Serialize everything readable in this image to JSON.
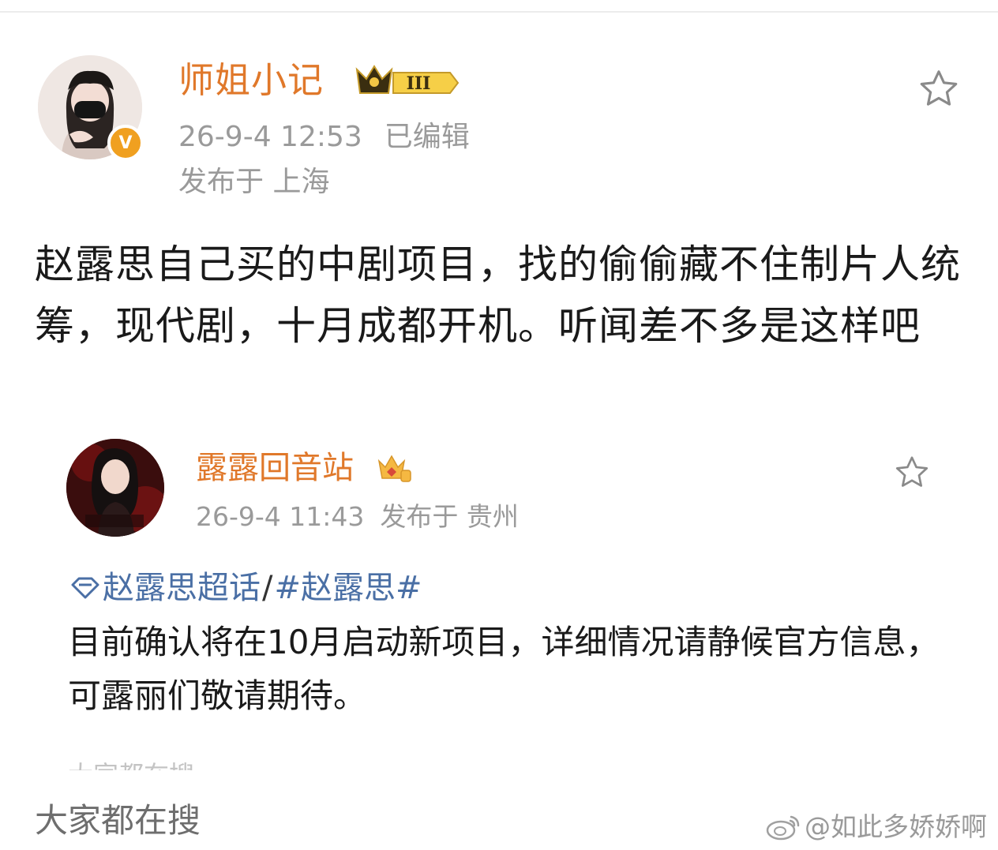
{
  "main_post": {
    "username": "师姐小记",
    "level_badge": "III",
    "verified_icon": "v-icon",
    "timestamp": "26-9-4 12:53",
    "edited": "已编辑",
    "location": "发布于 上海",
    "content": "赵露思自己买的中剧项目，找的偷偷藏不住制片人统筹，现代剧，十月成都开机。听闻差不多是这样吧"
  },
  "quoted_post": {
    "username": "露露回音站",
    "timestamp": "26-9-4 11:43",
    "location": "发布于 贵州",
    "topic": "赵露思超话",
    "topic_separator": "/",
    "hashtag": "#赵露思#",
    "content": "目前确认将在10月启动新项目，详细情况请静候官方信息，可露丽们敬请期待。",
    "cut_text": "大家都在搜"
  },
  "footer": {
    "search_title": "大家都在搜",
    "watermark": "@如此多娇娇啊"
  },
  "colors": {
    "username": "#e0782a",
    "meta": "#9a9a9a",
    "topic_link": "#4a6fa5",
    "verified_badge": "#f0a020"
  },
  "icons": [
    "star-icon",
    "crown-icon",
    "diamond-topic-icon",
    "weibo-logo-icon"
  ]
}
